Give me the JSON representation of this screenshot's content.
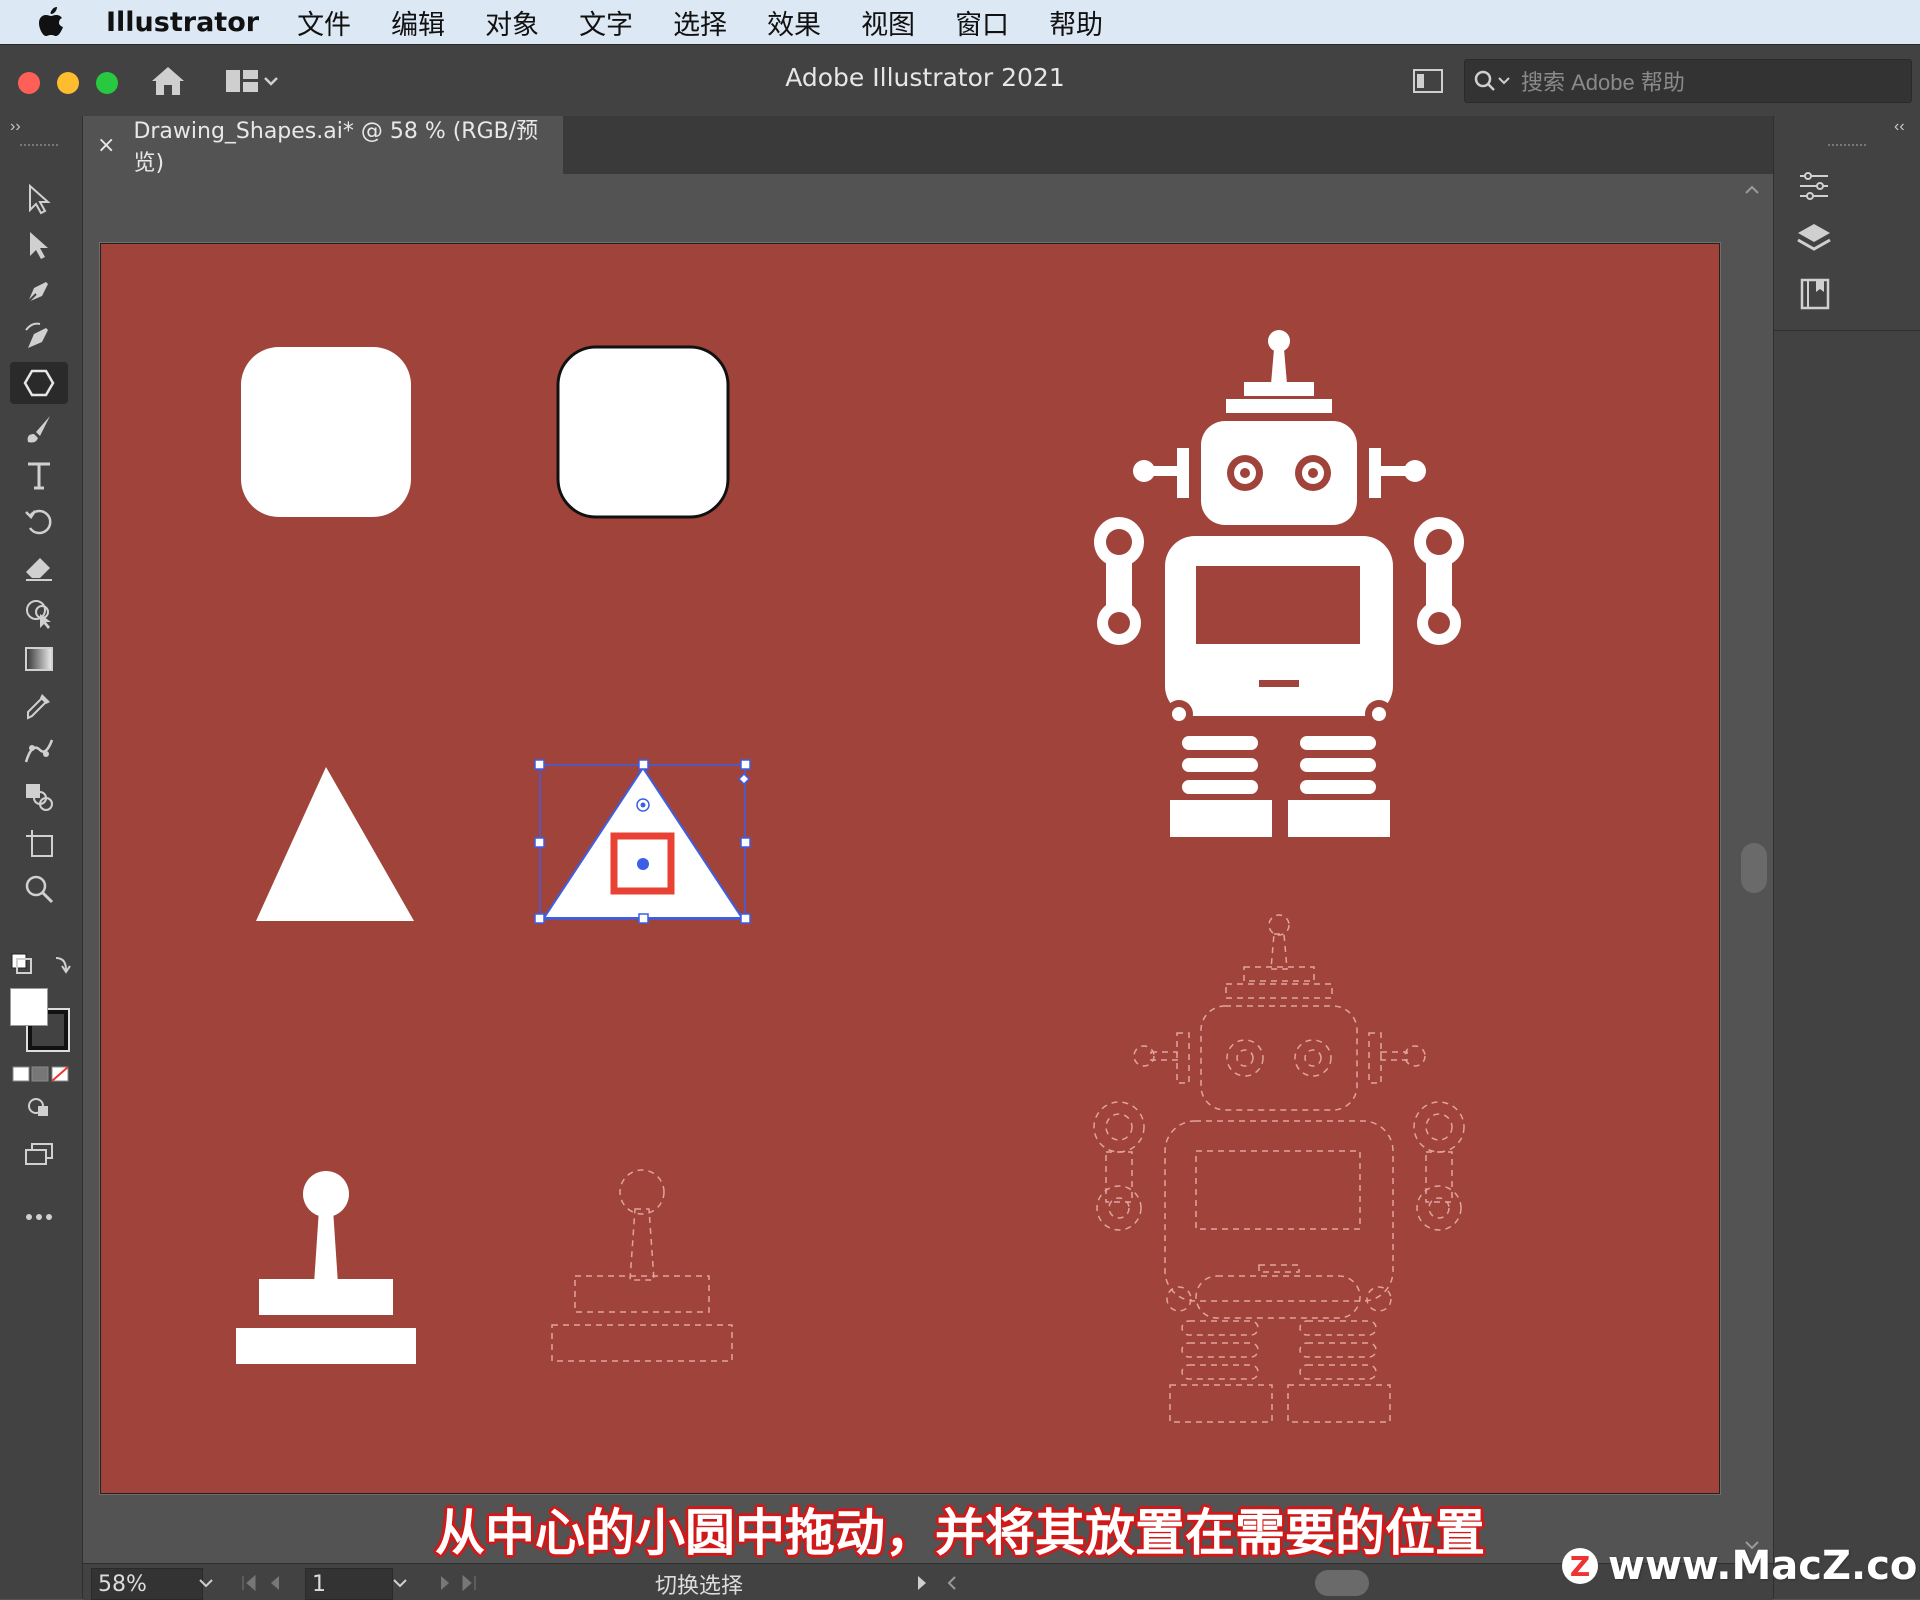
{
  "menubar": {
    "app_name": "Illustrator",
    "items": [
      "文件",
      "编辑",
      "对象",
      "文字",
      "选择",
      "效果",
      "视图",
      "窗口",
      "帮助"
    ]
  },
  "titlebar": {
    "title": "Adobe Illustrator 2021",
    "search_placeholder": "搜索 Adobe 帮助"
  },
  "tabs": [
    {
      "label": "Drawing_Shapes.ai* @ 58 % (RGB/预览)",
      "close": "×"
    }
  ],
  "tools": [
    "selection-tool-icon",
    "direct-selection-tool-icon",
    "pen-tool-icon",
    "curvature-tool-icon",
    "polygon-tool-icon",
    "paintbrush-tool-icon",
    "type-tool-icon",
    "rotate-tool-icon",
    "eraser-tool-icon",
    "shape-builder-tool-icon",
    "gradient-tool-icon",
    "eyedropper-tool-icon",
    "puppet-warp-tool-icon",
    "blend-tool-icon",
    "artboard-tool-icon",
    "zoom-tool-icon"
  ],
  "right_panel_icons": [
    "properties-icon",
    "layers-icon",
    "libraries-icon"
  ],
  "status": {
    "zoom": "58%",
    "page": "1",
    "mode": "切换选择"
  },
  "caption": "从中心的小圆中拖动，并将其放置在需要的位置",
  "watermark": "www.MacZ.com",
  "colors": {
    "artboard": "#a0433a",
    "selection": "#3d5ee6",
    "highlight": "#e94235"
  }
}
